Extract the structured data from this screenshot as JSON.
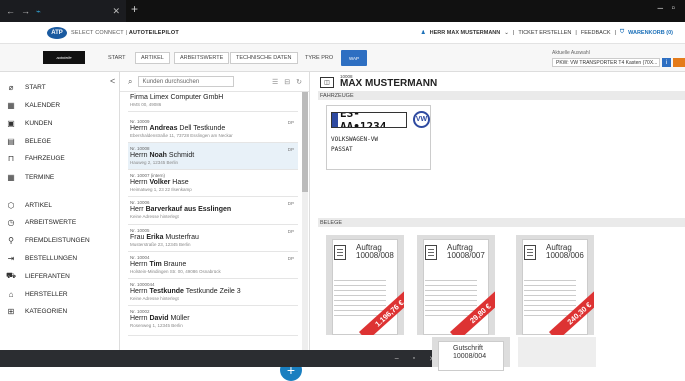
{
  "app": {
    "name_prefix": "SELECT CONNECT |",
    "name_main": "AUTOTEILEPILOT",
    "logo": "ATP"
  },
  "header": {
    "user": "HERR MAX MUSTERMANN",
    "ticket": "TICKET ERSTELLEN",
    "feedback": "FEEDBACK",
    "cart": "WARENKORB (0)"
  },
  "nav": {
    "brand": "autoteile",
    "tabs": [
      "START",
      "ARTIKEL",
      "ARBEITSWERTE",
      "TECHNISCHE DATEN",
      "TYRE PRO"
    ],
    "wap": "WAP",
    "vehicle_label": "Aktuelle Auswahl",
    "vehicle_value": "PKW: VW TRANSPORTER T4 Kasten (70X...",
    "info": "i"
  },
  "sidebar": {
    "items": [
      {
        "label": "START",
        "icon": "compass-icon",
        "glyph": "⌀"
      },
      {
        "label": "KALENDER",
        "icon": "calendar-icon",
        "glyph": "▦"
      },
      {
        "label": "KUNDEN",
        "icon": "contact-card-icon",
        "glyph": "▣"
      },
      {
        "label": "BELEGE",
        "icon": "document-icon",
        "glyph": "▤"
      },
      {
        "label": "FAHRZEUGE",
        "icon": "car-icon",
        "glyph": "⊓"
      },
      {
        "label": "TERMINE",
        "icon": "calendar-grid-icon",
        "glyph": "▦"
      },
      {
        "label": "ARTIKEL",
        "icon": "cube-icon",
        "glyph": "⬡"
      },
      {
        "label": "ARBEITSWERTE",
        "icon": "clock-icon",
        "glyph": "◷"
      },
      {
        "label": "FREMDLEISTUNGEN",
        "icon": "wrench-icon",
        "glyph": "⚲"
      },
      {
        "label": "BESTELLUNGEN",
        "icon": "order-icon",
        "glyph": "⇥"
      },
      {
        "label": "LIEFERANTEN",
        "icon": "truck-icon",
        "glyph": "⛟"
      },
      {
        "label": "HERSTELLER",
        "icon": "factory-icon",
        "glyph": "⌂"
      },
      {
        "label": "KATEGORIEN",
        "icon": "category-icon",
        "glyph": "⊞"
      }
    ]
  },
  "search": {
    "placeholder": "Kunden durchsuchen"
  },
  "customers": [
    {
      "nr": "",
      "name": "Firma Limex Computer GmbH",
      "first": "",
      "address": "HMS 00, 49086",
      "dp": ""
    },
    {
      "nr": "Nr. 10009",
      "name": "Herrn ",
      "first": "Andreas",
      "last": "Dell Testkunde",
      "address": "Ebershaldenstraße 11, 73728 Esslingen am Neckar",
      "dp": "DP"
    },
    {
      "nr": "Nr. 10008",
      "name": "Herrn ",
      "first": "Noah",
      "last": "Schmidt",
      "address": "Hauweg 2, 12345 Berlin",
      "dp": "DP"
    },
    {
      "nr": "Nr. 10007 (intern)",
      "name": "Herrn ",
      "first": "Volker",
      "last": "Hase",
      "address": "Heimatweg 1, 23 22 Ilsenkamp",
      "dp": ""
    },
    {
      "nr": "Nr. 10006",
      "name": "Herr ",
      "first": "Barverkauf aus Esslingen",
      "last": "",
      "address": "Keine Adresse hinterlegt",
      "dp": "DP"
    },
    {
      "nr": "Nr. 10005",
      "name": "Frau ",
      "first": "Erika",
      "last": "Musterfrau",
      "address": "Musterstraße 23, 12345 Berlin",
      "dp": "DP"
    },
    {
      "nr": "Nr. 10004",
      "name": "Herrn ",
      "first": "Tim",
      "last": "Braune",
      "address": "Holstein-Mindingen Str. 00, 49086 Osnabrück",
      "dp": "DP"
    },
    {
      "nr": "Nr. 1000044",
      "name": "Herrn ",
      "first": "Testkunde",
      "last": "Testkunde Zeile 3",
      "address": "Keine Adresse hinterlegt",
      "dp": ""
    },
    {
      "nr": "Nr. 10002",
      "name": "Herrn ",
      "first": "David",
      "last": "Müller",
      "address": "Rosenweg 1, 12345 Berlin",
      "dp": ""
    }
  ],
  "detail": {
    "customer_nr": "10008",
    "customer_name": "MAX MUSTERMANN",
    "section_vehicles": "FAHRZEUGE",
    "plate": "ES-AA•1234",
    "make": "VOLKSWAGEN-VW",
    "model": "PASSAT",
    "vw": "VW",
    "section_documents": "BELEGE",
    "documents": [
      {
        "type": "Auftrag",
        "number": "10008/008",
        "amount": "1.196,76 €"
      },
      {
        "type": "Auftrag",
        "number": "10008/007",
        "amount": "29,80 €"
      },
      {
        "type": "Auftrag",
        "number": "10008/006",
        "amount": "240,30 €"
      },
      {
        "type": "Gutschrift",
        "number": "10008/004",
        "amount": ""
      }
    ]
  },
  "colors": {
    "accent": "#2e6fc2",
    "ribbon": "#d33333",
    "selected_row": "#e8f1f8"
  }
}
